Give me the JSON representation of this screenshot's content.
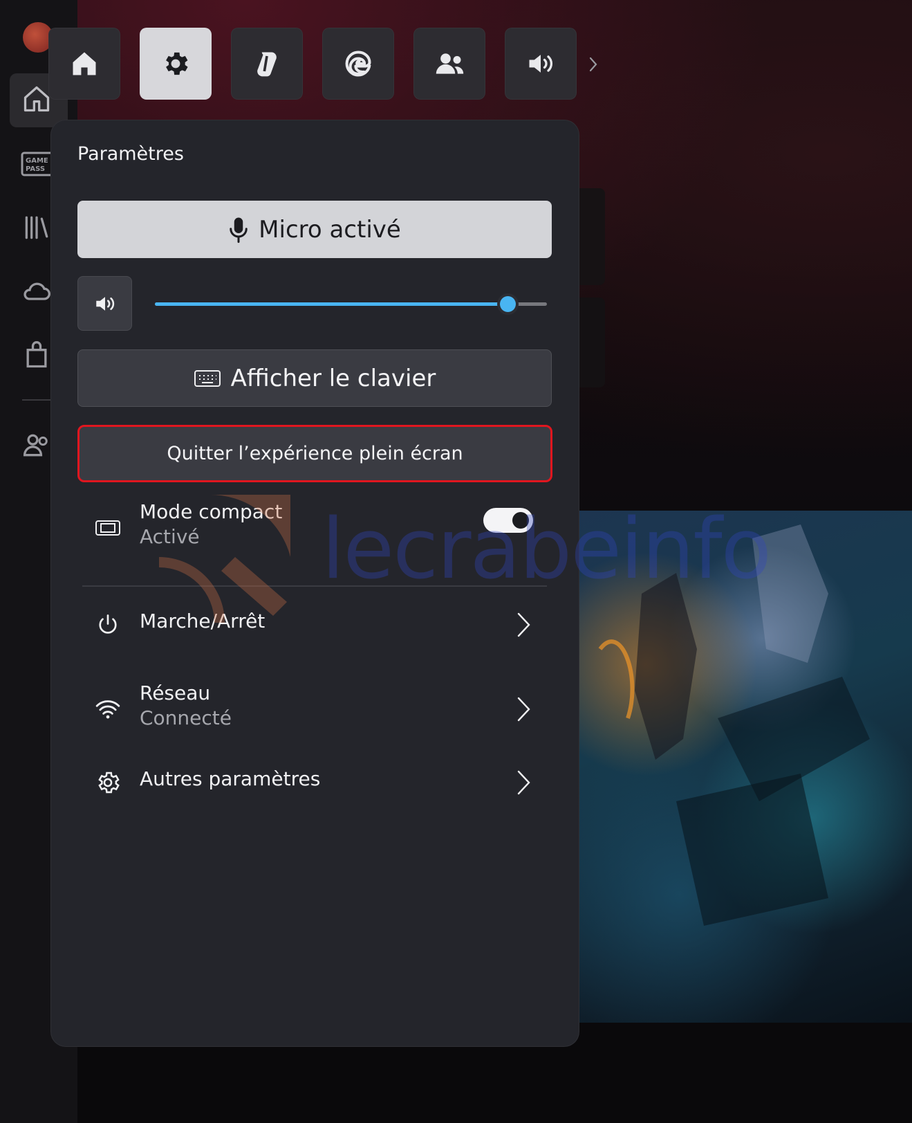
{
  "quick_bar": {
    "buttons": [
      {
        "name": "home-icon",
        "active": false
      },
      {
        "name": "gear-icon",
        "active": true
      },
      {
        "name": "copilot-icon",
        "active": false
      },
      {
        "name": "edge-icon",
        "active": false
      },
      {
        "name": "people-icon",
        "active": false
      },
      {
        "name": "volume-icon",
        "active": false
      }
    ],
    "more_icon": "chevron-right-icon"
  },
  "sidebar": {
    "items": [
      {
        "icon": "xbox-logo"
      },
      {
        "icon": "home-icon",
        "selected": true
      },
      {
        "icon": "game-pass-icon",
        "label_lines": [
          "GAME",
          "PASS"
        ]
      },
      {
        "icon": "library-icon"
      },
      {
        "icon": "cloud-icon"
      },
      {
        "icon": "store-icon"
      },
      {
        "icon": "friends-icon"
      }
    ]
  },
  "panel": {
    "title": "Paramètres",
    "mic_button_label": "Micro activé",
    "volume": {
      "level": 0.9,
      "accent": "#49b5f2"
    },
    "keyboard_button_label": "Afficher le clavier",
    "quit_button_label": "Quitter l’expérience plein écran",
    "quit_highlight_color": "#e0161f",
    "rows": {
      "compact": {
        "label": "Mode compact",
        "status": "Activé",
        "toggle_on": true
      },
      "power": {
        "label": "Marche/Arrêt"
      },
      "network": {
        "label": "Réseau",
        "status": "Connecté"
      },
      "more": {
        "label": "Autres paramètres"
      }
    }
  },
  "watermark": {
    "text": "lecrabeinfo"
  }
}
